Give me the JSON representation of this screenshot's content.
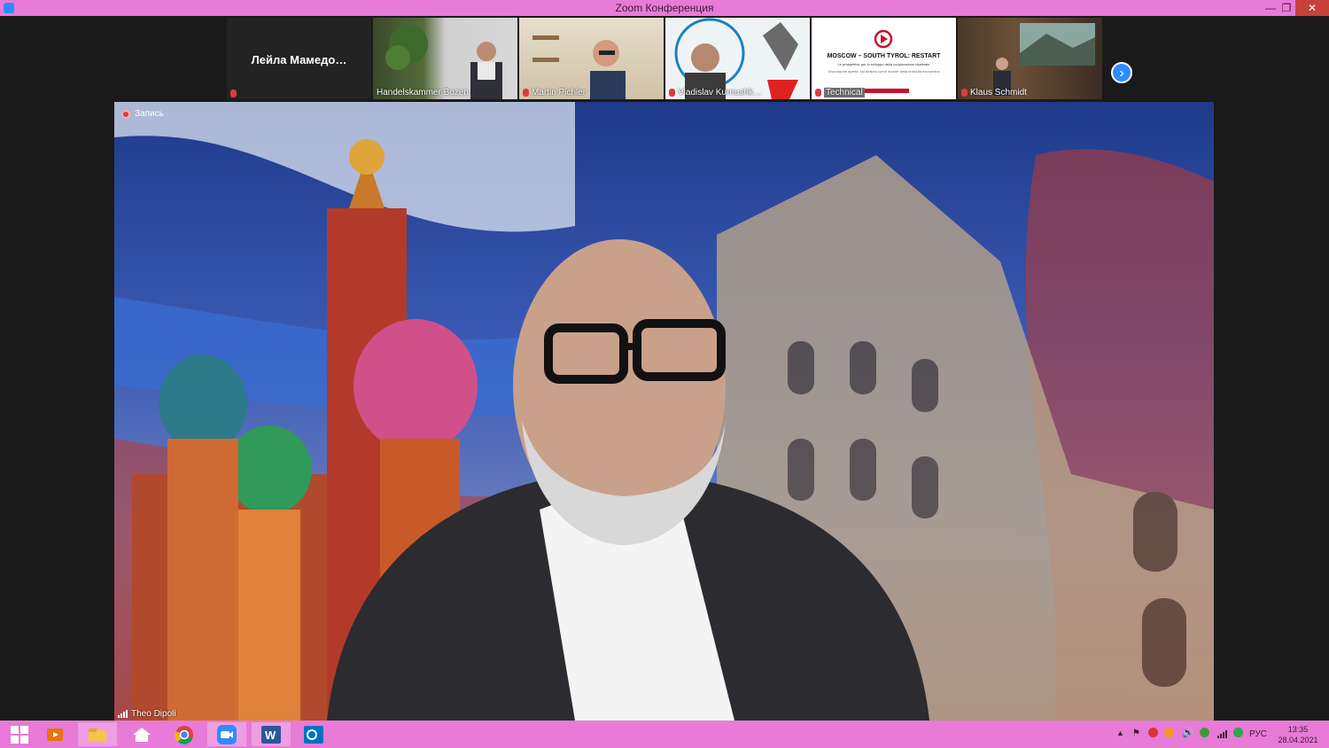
{
  "window": {
    "title": "Zoom Конференция"
  },
  "participants": [
    {
      "name": "Лейла  Мамедо…",
      "muted": true,
      "video": false
    },
    {
      "name": "Handelskammer Bozen",
      "muted": false,
      "video": true
    },
    {
      "name": "Martin Pichler",
      "muted": true,
      "video": true
    },
    {
      "name": "Vladislav Kurnushk…",
      "muted": true,
      "video": true
    },
    {
      "name": "Technical",
      "muted": true,
      "video": true
    },
    {
      "name": "Klaus Schmidt",
      "muted": true,
      "video": true
    }
  ],
  "slide": {
    "title": "MOSCOW – SOUTH TYROL: RESTART",
    "subtitle": "Le prospettive per lo sviluppo della cooperazione bilaterale",
    "caption": "Discussione aperta: sul turismo come motore della rinascita economica"
  },
  "recording": {
    "label": "Запись"
  },
  "active_speaker": {
    "name": "Theo Dipoli"
  },
  "taskbar": {
    "apps": [
      "start",
      "media-player",
      "file-explorer",
      "home",
      "chrome",
      "zoom",
      "word",
      "outlook"
    ],
    "language": "РУС",
    "time": "13:35",
    "date": "28.04.2021"
  },
  "colors": {
    "titlebar": "#e77bd7",
    "zoom_blue": "#2d8cff",
    "muted_red": "#e0393e"
  }
}
